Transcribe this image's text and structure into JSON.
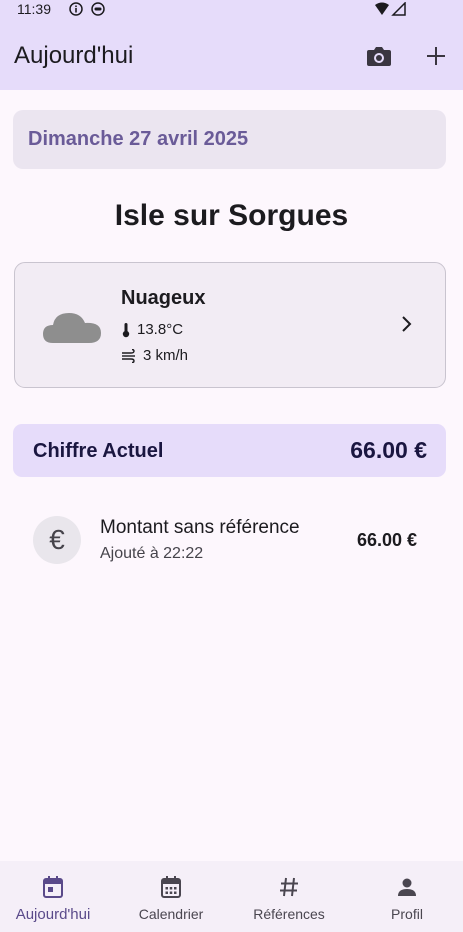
{
  "status": {
    "time": "11:39"
  },
  "appbar": {
    "title": "Aujourd'hui"
  },
  "date": "Dimanche 27 avril 2025",
  "city": "Isle sur Sorgues",
  "weather": {
    "condition": "Nuageux",
    "temperature": "13.8°C",
    "wind": "3 km/h"
  },
  "total": {
    "label": "Chiffre Actuel",
    "value": "66.00 €"
  },
  "entries": [
    {
      "title": "Montant sans référence",
      "subtitle": "Ajouté à 22:22",
      "amount": "66.00 €",
      "icon": "€"
    }
  ],
  "nav": [
    {
      "label": "Aujourd'hui",
      "icon": "today-icon"
    },
    {
      "label": "Calendrier",
      "icon": "calendar-icon"
    },
    {
      "label": "Références",
      "icon": "hashtag-icon"
    },
    {
      "label": "Profil",
      "icon": "person-icon"
    }
  ],
  "colors": {
    "accent": "#e6dcfa",
    "primary_text": "#6a5b98"
  }
}
